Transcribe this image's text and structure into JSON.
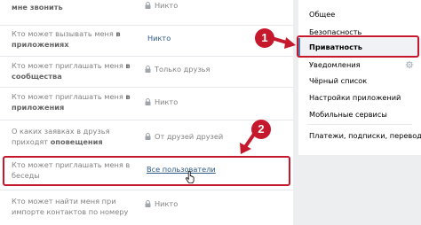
{
  "settings_rows": [
    {
      "label_pre": "",
      "label_bold": "мне звонить",
      "value": "Никто",
      "locked": true,
      "style": "grey"
    },
    {
      "label_pre": "Кто может вызывать меня ",
      "label_bold": "в приложениях",
      "value": "Никто",
      "locked": false,
      "style": "link"
    },
    {
      "label_pre": "Кто может приглашать меня ",
      "label_bold": "в сообщества",
      "value": "Только друзья",
      "locked": true,
      "style": "grey"
    },
    {
      "label_pre": "Кто может приглашать меня ",
      "label_bold": "в приложения",
      "value": "Никто",
      "locked": true,
      "style": "grey"
    },
    {
      "label_pre": "О каких заявках в друзья приходят ",
      "label_bold": "оповещения",
      "value": "От друзей друзей",
      "locked": true,
      "style": "grey"
    },
    {
      "label_pre": "Кто может приглашать меня в беседы",
      "label_bold": "",
      "value": "Все пользователи",
      "locked": false,
      "style": "underline"
    },
    {
      "label_pre": "Кто может найти меня при импорте контактов по номеру",
      "label_bold": "",
      "value": "Никто",
      "locked": true,
      "style": "grey"
    }
  ],
  "menu": {
    "items": [
      {
        "label": "Общее"
      },
      {
        "label": "Безопасность"
      },
      {
        "label": "Приватность",
        "active": true
      },
      {
        "label": "Уведомления",
        "gear": true
      },
      {
        "label": "Чёрный список"
      },
      {
        "label": "Настройки приложений"
      },
      {
        "label": "Мобильные сервисы"
      },
      {
        "label": "Платежи, подписки, переводы"
      }
    ]
  },
  "annotations": {
    "badge_1": "1",
    "badge_2": "2",
    "color": "#c6182c"
  },
  "icons": [
    "lock-icon",
    "gear-icon",
    "hand-cursor-icon"
  ]
}
